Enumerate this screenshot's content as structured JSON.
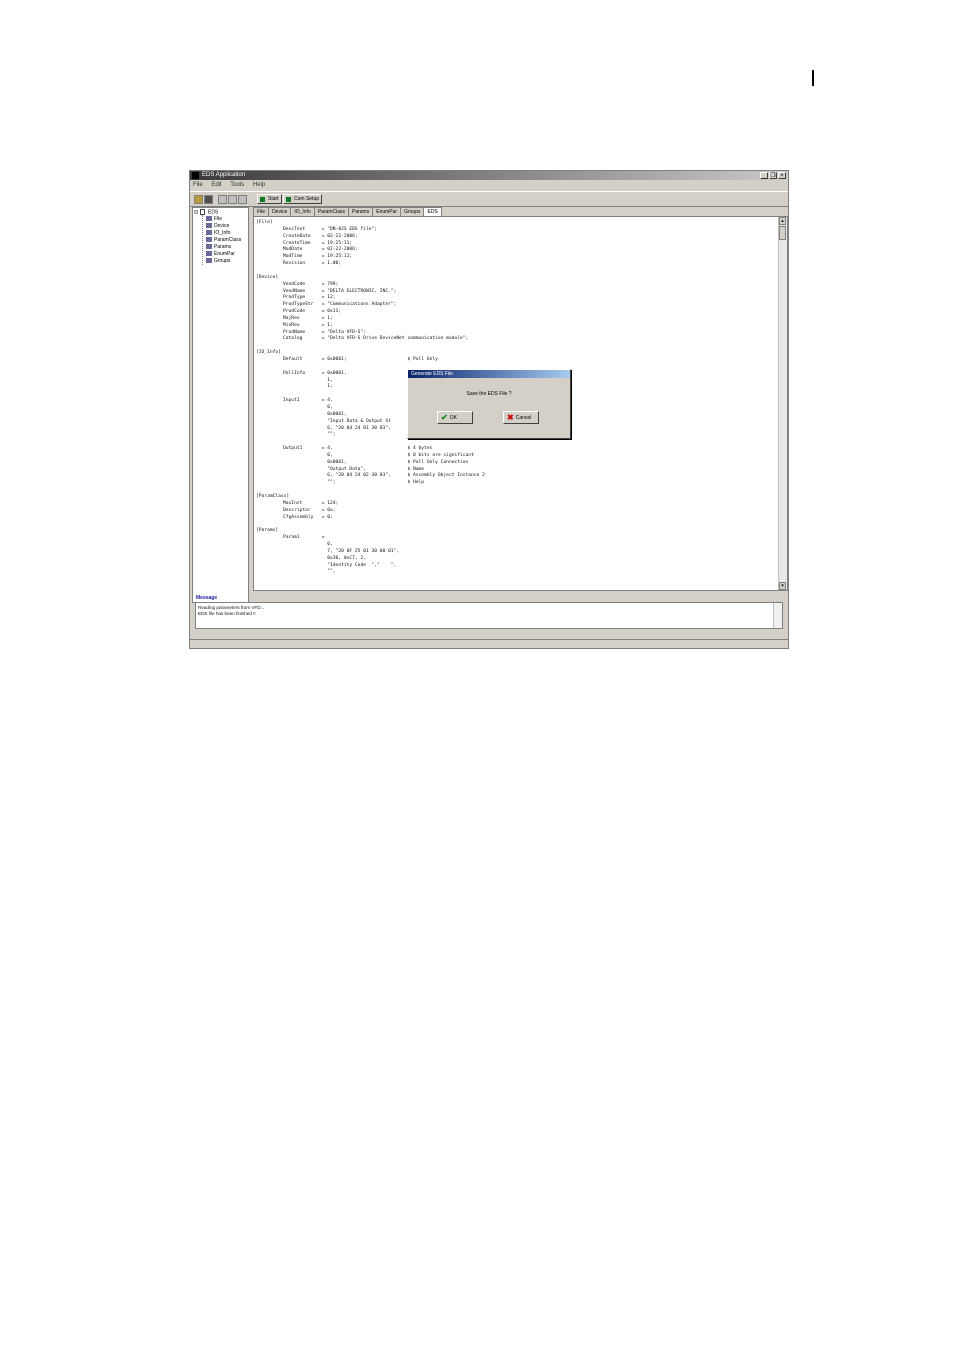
{
  "window": {
    "title": "EDS Application",
    "controls": [
      "_",
      "❒",
      "×"
    ]
  },
  "menu": [
    "File",
    "Edit",
    "Tools",
    "Help"
  ],
  "toolbar": {
    "start": "Start",
    "com_setup": "Com Setup"
  },
  "tree": {
    "root": "EDS",
    "items": [
      "File",
      "Device",
      "IO_Info",
      "ParamClass",
      "Params",
      "EnumPar",
      "Groups"
    ]
  },
  "tabs": [
    "File",
    "Device",
    "IO_Info",
    "ParamClass",
    "Params",
    "EnumPar",
    "Groups",
    "EDS"
  ],
  "active_tab": "EDS",
  "code": [
    {
      "t": "[File]",
      "i": 0
    },
    {
      "t": "DescText      = \"DN-02S EDS file\";",
      "i": 1
    },
    {
      "t": "CreateDate    = 02-22-2006;",
      "i": 1
    },
    {
      "t": "CreateTime    = 19:25:11;",
      "i": 1
    },
    {
      "t": "ModDate       = 02-22-2006;",
      "i": 1
    },
    {
      "t": "ModTime       = 19:25:11;",
      "i": 1
    },
    {
      "t": "Revision      = 1.00;",
      "i": 1
    },
    {
      "t": "",
      "i": 0
    },
    {
      "t": "[Device]",
      "i": 0
    },
    {
      "t": "VendCode      = 799;",
      "i": 1
    },
    {
      "t": "VendName      = \"DELTA ELECTRONIC, INC.\";",
      "i": 1
    },
    {
      "t": "ProdType      = 12;",
      "i": 1
    },
    {
      "t": "ProdTypeStr   = \"Communications Adapter\";",
      "i": 1
    },
    {
      "t": "ProdCode      = 0x11;",
      "i": 1
    },
    {
      "t": "MajRev        = 1;",
      "i": 1
    },
    {
      "t": "MinRev        = 1;",
      "i": 1
    },
    {
      "t": "ProdName      = \"Delta VFD-S\";",
      "i": 1
    },
    {
      "t": "Catalog       = \"Delta VFD-S Drive DeviceNet communication module\";",
      "i": 1
    },
    {
      "t": "",
      "i": 0
    },
    {
      "t": "[IO_Info]",
      "i": 0
    },
    {
      "t": "Default       = 0x0001;                      $ Poll Only",
      "i": 1
    },
    {
      "t": "",
      "i": 0
    },
    {
      "t": "PollInfo      = 0x0001,",
      "i": 1
    },
    {
      "t": "                1,",
      "i": 1
    },
    {
      "t": "                1;",
      "i": 1
    },
    {
      "t": "",
      "i": 0
    },
    {
      "t": "Input1        = 4,",
      "i": 1
    },
    {
      "t": "                0,",
      "i": 1
    },
    {
      "t": "                0x0001,",
      "i": 1
    },
    {
      "t": "                \"Input Data & Output St",
      "i": 1
    },
    {
      "t": "                6, \"20 04 24 01 30 03\",",
      "i": 1
    },
    {
      "t": "                \"\";                          $ Help",
      "i": 1
    },
    {
      "t": "",
      "i": 0
    },
    {
      "t": "Output1       = 4,                           $ 4 bytes",
      "i": 1
    },
    {
      "t": "                0,                           $ 0 bits are significant",
      "i": 1
    },
    {
      "t": "                0x0001,                      $ Poll Only Connection",
      "i": 1
    },
    {
      "t": "                \"Output Data\",               $ Name",
      "i": 1
    },
    {
      "t": "                6, \"20 04 24 02 30 03\",      $ Assembly Object Instance 2",
      "i": 1
    },
    {
      "t": "                \"\";                          $ Help",
      "i": 1
    },
    {
      "t": "",
      "i": 0
    },
    {
      "t": "[ParamClass]",
      "i": 0
    },
    {
      "t": "MaxInst       = 124;",
      "i": 1
    },
    {
      "t": "Descriptor    = 0x;",
      "i": 1
    },
    {
      "t": "CfgAssembly   = 0;",
      "i": 1
    },
    {
      "t": "",
      "i": 0
    },
    {
      "t": "[Params]",
      "i": 0
    },
    {
      "t": "Param1        =",
      "i": 1
    },
    {
      "t": "                0,",
      "i": 1
    },
    {
      "t": "                7, \"20 0F 25 01 30 00 01\",",
      "i": 1
    },
    {
      "t": "                0x30, 0xC7, 2,",
      "i": 1
    },
    {
      "t": "                \"Identity Code  \",\"    \",",
      "i": 1
    },
    {
      "t": "                \"\",",
      "i": 1
    }
  ],
  "dialog": {
    "title": "Generate EDS File",
    "message": "Save the EDS File ?",
    "ok": "OK",
    "cancel": "Cancel"
  },
  "messages": {
    "label": "Message",
    "lines": [
      "Reading parameters from VFD...",
      "EDS file has been finished !!"
    ]
  }
}
